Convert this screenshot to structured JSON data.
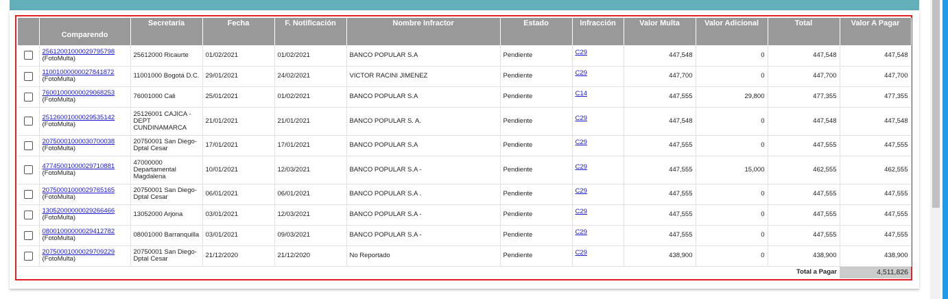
{
  "headers": {
    "comparendo": "Comparendo",
    "secretaria": "Secretaría",
    "fecha": "Fecha",
    "notificacion": "F. Notificación",
    "infractor": "Nombre Infractor",
    "estado": "Estado",
    "infraccion": "Infracción",
    "valor_multa": "Valor Multa",
    "valor_adicional": "Valor Adicional",
    "total": "Total",
    "valor_pagar": "Valor A Pagar"
  },
  "rows": [
    {
      "comparendo": "25612001000029795798",
      "tipo": "(FotoMulta)",
      "secretaria": "25612000 Ricaurte",
      "fecha": "01/02/2021",
      "notificacion": "01/02/2021",
      "infractor": "BANCO POPULAR S.A",
      "estado": "Pendiente",
      "infraccion": "C29",
      "valor_multa": "447,548",
      "valor_adicional": "0",
      "total": "447,548",
      "valor_pagar": "447,548"
    },
    {
      "comparendo": "11001000000027841872",
      "tipo": "(FotoMulta)",
      "secretaria": "11001000 Bogotá D.C.",
      "fecha": "29/01/2021",
      "notificacion": "24/02/2021",
      "infractor": "VICTOR RACINI JIMENEZ",
      "estado": "Pendiente",
      "infraccion": "C29",
      "valor_multa": "447,700",
      "valor_adicional": "0",
      "total": "447,700",
      "valor_pagar": "447,700"
    },
    {
      "comparendo": "76001000000029068253",
      "tipo": "(FotoMulta)",
      "secretaria": "76001000 Cali",
      "fecha": "25/01/2021",
      "notificacion": "01/02/2021",
      "infractor": "BANCO POPULAR S.A",
      "estado": "Pendiente",
      "infraccion": "C14",
      "valor_multa": "447,555",
      "valor_adicional": "29,800",
      "total": "477,355",
      "valor_pagar": "477,355"
    },
    {
      "comparendo": "25126001000029535142",
      "tipo": "(FotoMulta)",
      "secretaria": "25126001 CAJICA - DEPT CUNDINAMARCA",
      "fecha": "21/01/2021",
      "notificacion": "21/01/2021",
      "infractor": "BANCO POPULAR S. A.",
      "estado": "Pendiente",
      "infraccion": "C29",
      "valor_multa": "447,548",
      "valor_adicional": "0",
      "total": "447,548",
      "valor_pagar": "447,548"
    },
    {
      "comparendo": "20750001000030700038",
      "tipo": "(FotoMulta)",
      "secretaria": "20750001 San Diego-Dptal Cesar",
      "fecha": "17/01/2021",
      "notificacion": "17/01/2021",
      "infractor": "BANCO POPULAR S.A",
      "estado": "Pendiente",
      "infraccion": "C29",
      "valor_multa": "447,555",
      "valor_adicional": "0",
      "total": "447,555",
      "valor_pagar": "447,555"
    },
    {
      "comparendo": "47745001000029710881",
      "tipo": "(FotoMulta)",
      "secretaria": "47000000 Departamental Magdalena",
      "fecha": "10/01/2021",
      "notificacion": "12/03/2021",
      "infractor": "BANCO POPULAR S.A -",
      "estado": "Pendiente",
      "infraccion": "C29",
      "valor_multa": "447,555",
      "valor_adicional": "15,000",
      "total": "462,555",
      "valor_pagar": "462,555"
    },
    {
      "comparendo": "20750001000029765165",
      "tipo": "(FotoMulta)",
      "secretaria": "20750001 San Diego-Dptal Cesar",
      "fecha": "06/01/2021",
      "notificacion": "06/01/2021",
      "infractor": "BANCO POPULAR S.A .",
      "estado": "Pendiente",
      "infraccion": "C29",
      "valor_multa": "447,555",
      "valor_adicional": "0",
      "total": "447,555",
      "valor_pagar": "447,555"
    },
    {
      "comparendo": "13052000000029266466",
      "tipo": "(FotoMulta)",
      "secretaria": "13052000 Arjona",
      "fecha": "03/01/2021",
      "notificacion": "12/03/2021",
      "infractor": "BANCO POPULAR S.A -",
      "estado": "Pendiente",
      "infraccion": "C29",
      "valor_multa": "447,555",
      "valor_adicional": "0",
      "total": "447,555",
      "valor_pagar": "447,555"
    },
    {
      "comparendo": "08001000000029412782",
      "tipo": "(FotoMulta)",
      "secretaria": "08001000 Barranquilla",
      "fecha": "03/01/2021",
      "notificacion": "09/03/2021",
      "infractor": "BANCO POPULAR S.A -",
      "estado": "Pendiente",
      "infraccion": "C29",
      "valor_multa": "447,555",
      "valor_adicional": "0",
      "total": "447,555",
      "valor_pagar": "447,555"
    },
    {
      "comparendo": "20750001000029709229",
      "tipo": "(FotoMulta)",
      "secretaria": "20750001 San Diego-Dptal Cesar",
      "fecha": "21/12/2020",
      "notificacion": "21/12/2020",
      "infractor": "No Reportado",
      "estado": "Pendiente",
      "infraccion": "C29",
      "valor_multa": "438,900",
      "valor_adicional": "0",
      "total": "438,900",
      "valor_pagar": "438,900"
    }
  ],
  "footer": {
    "total_label": "Total a Pagar",
    "total_value": "4,511,826"
  }
}
